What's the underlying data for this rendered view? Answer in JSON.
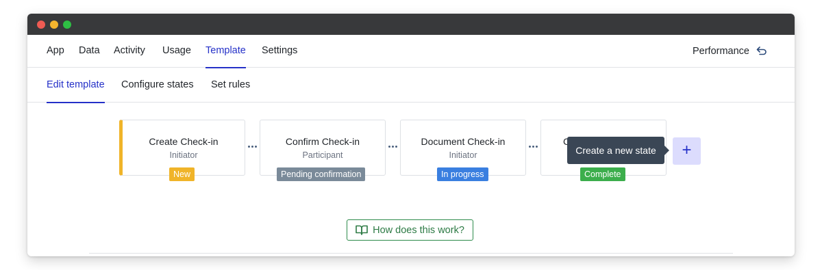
{
  "colors": {
    "close": "#ee5b53",
    "minimize": "#f5b52e",
    "maximize": "#2ebf44",
    "accent": "#2430c8",
    "new": "#f0b429",
    "pending": "#7a8a99",
    "in_progress": "#3a7fe0",
    "complete": "#3cae4c"
  },
  "topnav": {
    "items": [
      "App",
      "Data",
      "Activity",
      "Usage",
      "Template",
      "Settings"
    ],
    "active": "Template",
    "performance_label": "Performance"
  },
  "subnav": {
    "items": [
      "Edit template",
      "Configure states",
      "Set rules"
    ],
    "active": "Edit template"
  },
  "states": [
    {
      "title": "Create Check-in",
      "role": "Initiator",
      "badge": "New"
    },
    {
      "title": "Confirm Check-in",
      "role": "Participant",
      "badge": "Pending confirmation"
    },
    {
      "title": "Document Check-in",
      "role": "Initiator",
      "badge": "In progress"
    },
    {
      "title": "C",
      "role": "",
      "badge": "Complete"
    }
  ],
  "tooltip": "Create a new state",
  "add_button": "+",
  "help_button": "How does this work?"
}
